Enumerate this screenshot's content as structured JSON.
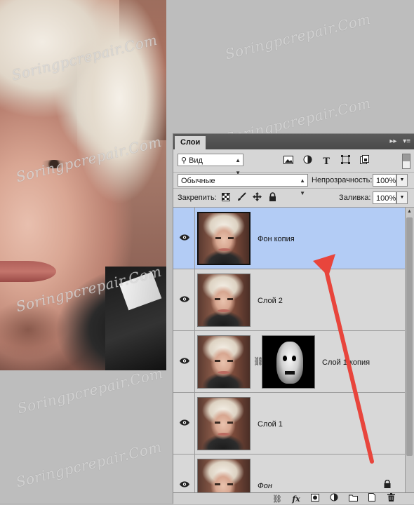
{
  "watermark": "Soringpcrepair.Com",
  "panel": {
    "tab_label": "Слои",
    "tab_controls": [
      "▸▸",
      "▾≡"
    ],
    "filter": {
      "value": "Вид",
      "icon": "search-icon"
    },
    "filter_icons": [
      "image-filter-icon",
      "adjustment-filter-icon",
      "type-filter-icon",
      "shape-filter-icon",
      "smart-object-filter-icon"
    ],
    "blend_mode": "Обычные",
    "opacity_label": "Непрозрачность:",
    "opacity_value": "100%",
    "lock_label": "Закрепить:",
    "lock_icons": [
      "lock-transparent-icon",
      "lock-image-icon",
      "lock-position-icon",
      "lock-all-icon"
    ],
    "fill_label": "Заливка:",
    "fill_value": "100%"
  },
  "layers": [
    {
      "name": "Фон копия",
      "selected": true,
      "has_mask": false
    },
    {
      "name": "Слой 2",
      "selected": false,
      "has_mask": false
    },
    {
      "name": "Слой 1 копия",
      "selected": false,
      "has_mask": true
    },
    {
      "name": "Слой 1",
      "selected": false,
      "has_mask": false
    },
    {
      "name": "Фон",
      "selected": false,
      "has_mask": false,
      "locked": true,
      "italic": true
    }
  ],
  "bottom_icons": [
    "link-layers-icon",
    "fx-icon",
    "add-mask-icon",
    "new-adjustment-icon",
    "new-group-icon",
    "new-layer-icon",
    "delete-icon"
  ],
  "annotation": {
    "arrow_color": "#e8453c"
  }
}
